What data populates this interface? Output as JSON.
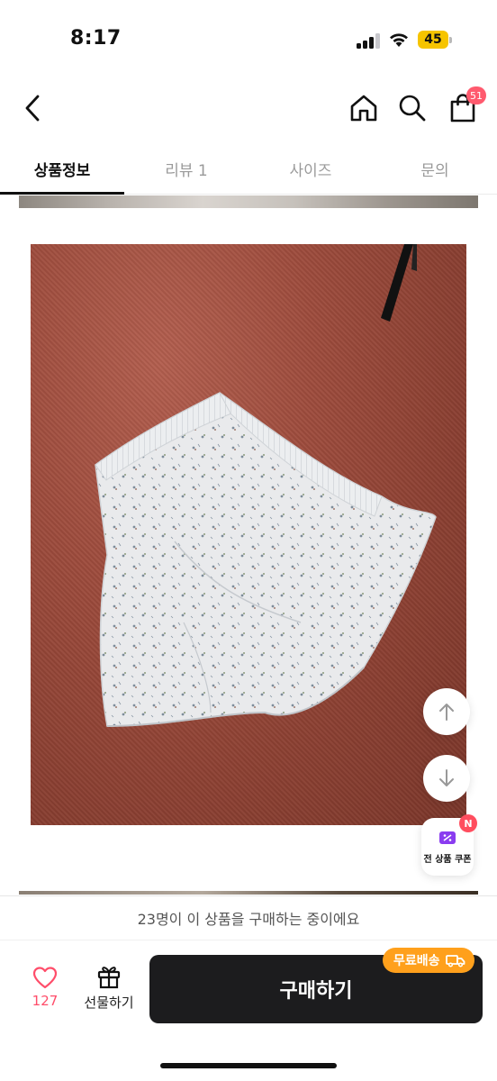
{
  "status_bar": {
    "time": "8:17",
    "battery": "45",
    "signal_bars": 3,
    "signal_bars_total": 4
  },
  "topnav": {
    "back_icon": "chevron-left-icon",
    "home_icon": "home-icon",
    "search_icon": "search-icon",
    "cart_icon": "shopping-bag-icon",
    "cart_count": "51"
  },
  "tabs": [
    {
      "label": "상품정보",
      "active": true
    },
    {
      "label": "리뷰 1",
      "active": false
    },
    {
      "label": "사이즈",
      "active": false
    },
    {
      "label": "문의",
      "active": false
    }
  ],
  "floating": {
    "scroll_up_icon": "arrow-up-icon",
    "scroll_down_icon": "arrow-down-icon",
    "coupon_label": "전 상품 쿠폰",
    "coupon_badge": "N"
  },
  "buying_notice": "23명이 이 상품을 구매하는 중이에요",
  "bottom": {
    "like_count": "127",
    "gift_label": "선물하기",
    "buy_label": "구매하기",
    "shipping_badge": "무료배송"
  },
  "colors": {
    "accent_pink": "#ff5a6e",
    "shipping_orange": "#ffa01c",
    "buy_button": "#1c1c1e"
  }
}
